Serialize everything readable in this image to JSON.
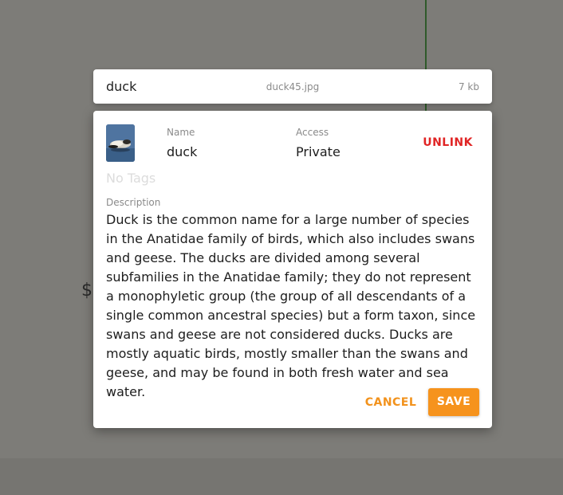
{
  "background": {
    "dollar_glyph": "$"
  },
  "file_bar": {
    "title": "duck",
    "filename": "duck45.jpg",
    "size": "7 kb"
  },
  "editor": {
    "thumbnail_icon": "duck-thumbnail",
    "name_label": "Name",
    "name_value": "duck",
    "access_label": "Access",
    "access_value": "Private",
    "unlink_label": "UNLINK",
    "tags_placeholder": "No Tags",
    "description_label": "Description",
    "description_text": "Duck is the common name for a large number of species in the Anatidae family of birds, which also includes swans and geese. The ducks are divided among several subfamilies in the Anatidae family; they do not represent a monophyletic group (the group of all descendants of a single common ancestral species) but a form taxon, since swans and geese are not considered ducks. Ducks are mostly aquatic birds, mostly smaller than the swans and geese, and may be found in both fresh water and sea water.",
    "cancel_label": "CANCEL",
    "save_label": "SAVE"
  },
  "colors": {
    "accent": "#f6931d",
    "danger": "#e02424",
    "overlay": "#7b7a76"
  }
}
